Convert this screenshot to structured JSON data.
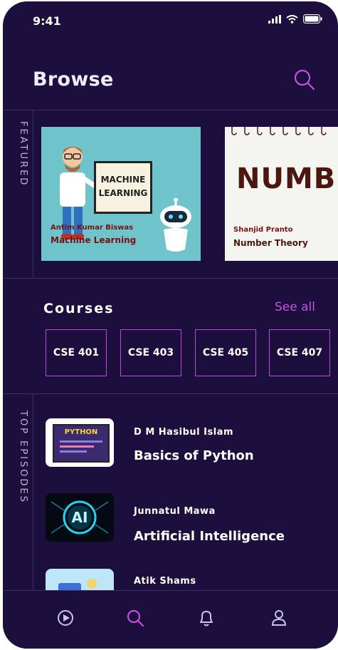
{
  "status_bar": {
    "time": "9:41"
  },
  "header": {
    "title": "Browse"
  },
  "featured": {
    "label": "FEATURED",
    "cards": [
      {
        "board_text": "MACHINE LEARNING",
        "author": "Antim Kumar Biswas",
        "course": "Machine Learning"
      },
      {
        "title_text": "NUMBE THEOR",
        "author": "Shanjid Pranto",
        "course": "Number Theory"
      }
    ]
  },
  "courses": {
    "title": "Courses",
    "see_all": "See all",
    "items": [
      "CSE 401",
      "CSE 403",
      "CSE 405",
      "CSE 407"
    ]
  },
  "top_episodes": {
    "label": "TOP EPISODES",
    "items": [
      {
        "author": "D M Hasibul Islam",
        "title": "Basics of Python",
        "thumb_text": "PYTHON"
      },
      {
        "author": "Junnatul Mawa",
        "title": "Artificial Intelligence",
        "thumb_text": "AI"
      },
      {
        "author": "Atik Shams",
        "title": ""
      }
    ]
  },
  "tabbar": {
    "tabs": [
      "play-icon",
      "search-icon",
      "bell-icon",
      "user-icon"
    ],
    "active": "search-icon"
  },
  "colors": {
    "background": "#1c0f3d",
    "accent": "#b34bd6",
    "divider": "#3b2d66"
  }
}
